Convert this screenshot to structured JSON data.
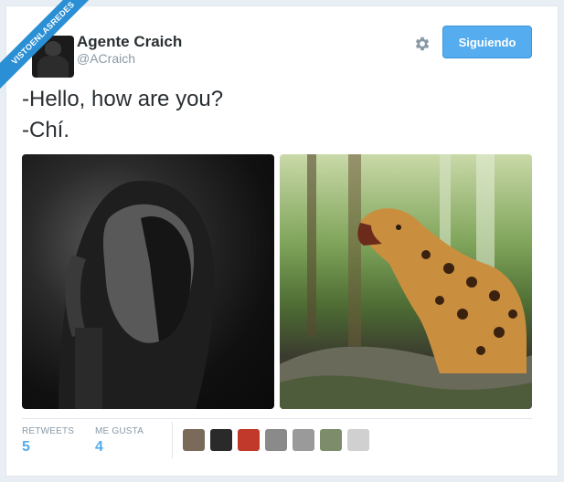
{
  "watermark": "VISTOENLASREDES",
  "tweet": {
    "author_name": "Agente Craich",
    "author_handle": "@ACraich",
    "follow_button_label": "Siguiendo",
    "text_lines": [
      "-Hello, how are you?",
      "-Chí."
    ]
  },
  "stats": {
    "retweets_label": "RETWEETS",
    "retweets_value": "5",
    "likes_label": "ME GUSTA",
    "likes_value": "4"
  },
  "likers": [
    {
      "color": "#7a6a5a"
    },
    {
      "color": "#2a2a2a"
    },
    {
      "color": "#c0392b"
    },
    {
      "color": "#8a8a8a"
    },
    {
      "color": "#9a9a9a"
    },
    {
      "color": "#7d8c6a"
    },
    {
      "color": "#d0d0d0"
    }
  ],
  "colors": {
    "accent": "#55acee",
    "text": "#292f33",
    "muted": "#8899a6"
  }
}
